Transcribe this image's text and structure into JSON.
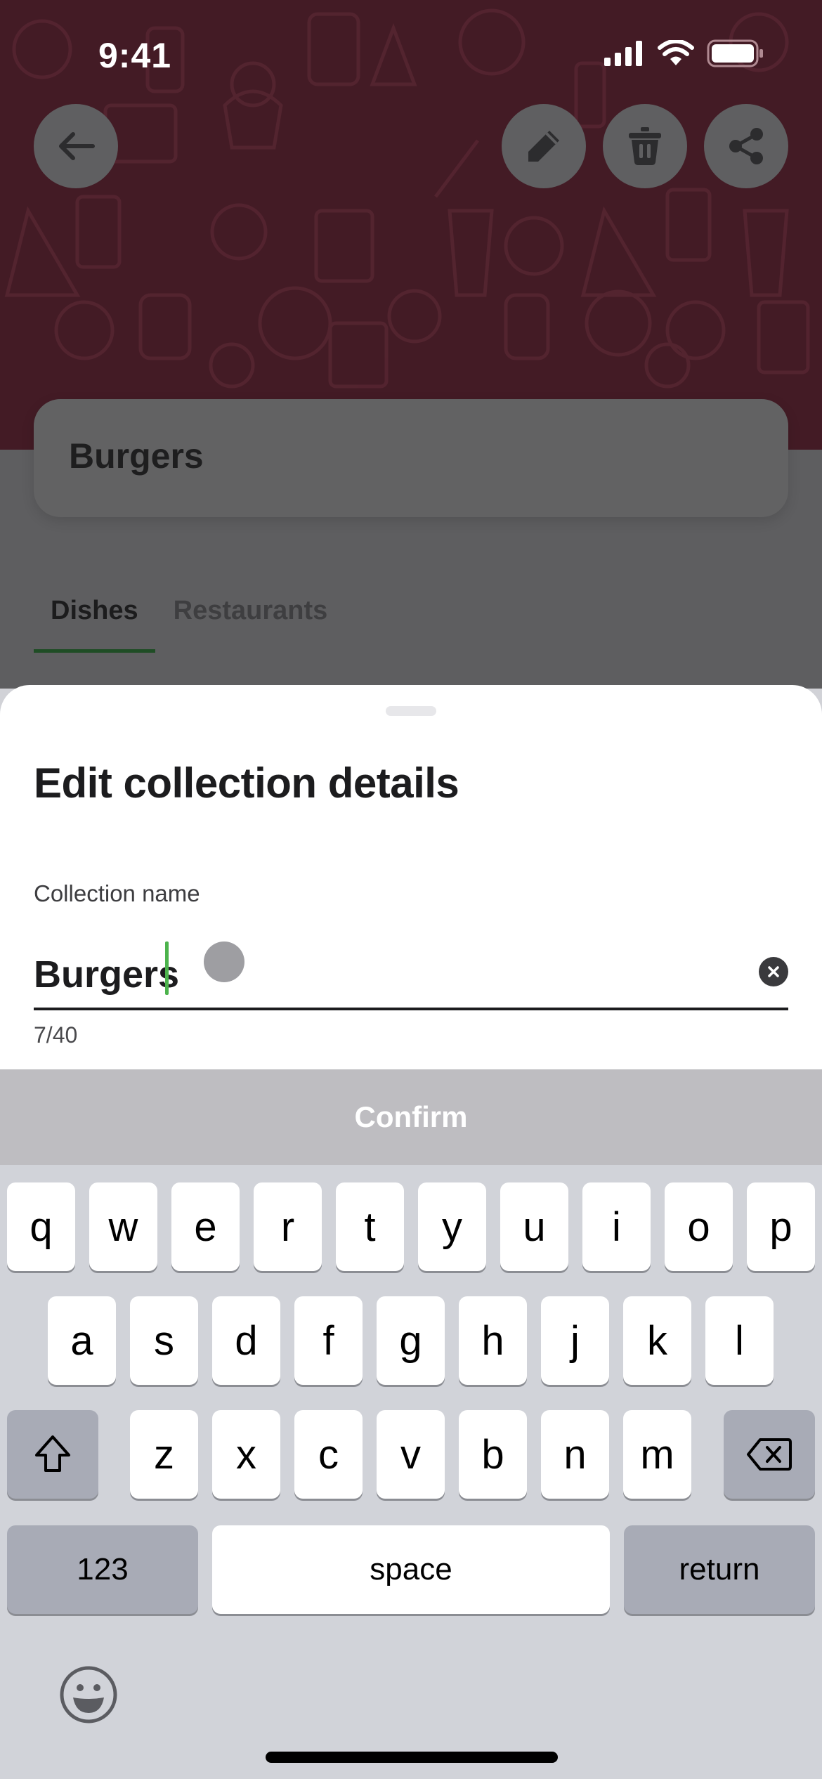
{
  "status_bar": {
    "time": "9:41",
    "icons": [
      "cellular-signal-icon",
      "wifi-icon",
      "battery-icon"
    ]
  },
  "header": {
    "back_icon": "arrow-left-icon",
    "actions": [
      {
        "name": "edit",
        "icon": "pencil-icon"
      },
      {
        "name": "delete",
        "icon": "trash-icon"
      },
      {
        "name": "share",
        "icon": "share-icon"
      }
    ]
  },
  "collection": {
    "title": "Burgers"
  },
  "tabs": [
    {
      "label": "Dishes",
      "active": true
    },
    {
      "label": "Restaurants",
      "active": false
    }
  ],
  "sheet": {
    "title": "Edit collection details",
    "field_label": "Collection name",
    "field_value": "Burgers",
    "char_count": "7/40",
    "clear_icon": "clear-circle-icon",
    "confirm_label": "Confirm"
  },
  "keyboard": {
    "row1": [
      "q",
      "w",
      "e",
      "r",
      "t",
      "y",
      "u",
      "i",
      "o",
      "p"
    ],
    "row2": [
      "a",
      "s",
      "d",
      "f",
      "g",
      "h",
      "j",
      "k",
      "l"
    ],
    "row3": [
      "z",
      "x",
      "c",
      "v",
      "b",
      "n",
      "m"
    ],
    "numbers_label": "123",
    "space_label": "space",
    "return_label": "return",
    "shift_icon": "shift-icon",
    "backspace_icon": "backspace-icon",
    "emoji_icon": "emoji-icon"
  },
  "colors": {
    "hero_background": "#431b25",
    "overlay_dim": "#5e5e60",
    "tab_indicator": "#1f4d25",
    "caret": "#4cb34c",
    "confirm_disabled": "#bebdc1",
    "keyboard_bg": "#d1d3d9"
  }
}
